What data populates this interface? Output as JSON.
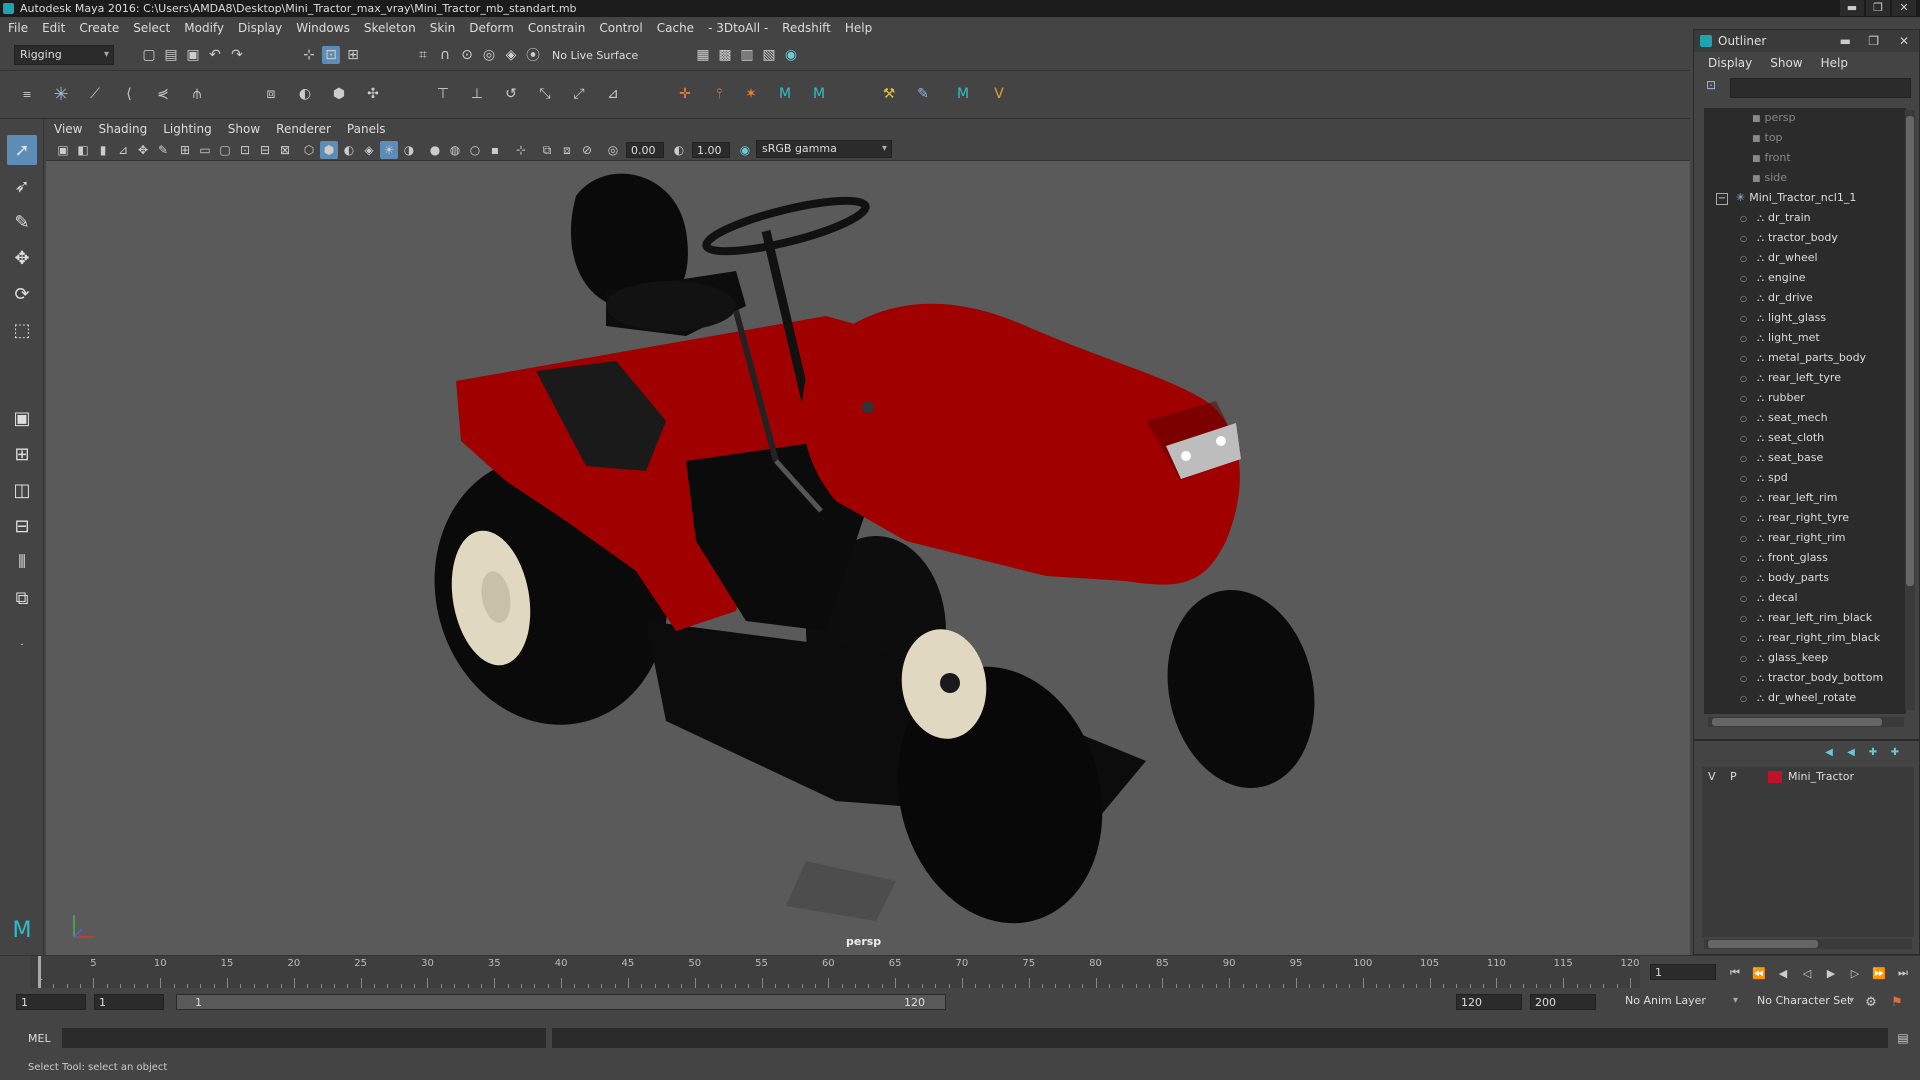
{
  "titlebar": {
    "title": "Autodesk Maya 2016: C:\\Users\\AMDA8\\Desktop\\Mini_Tractor_max_vray\\Mini_Tractor_mb_standart.mb",
    "min": "▬",
    "max": "❐",
    "close": "✕"
  },
  "menubar": {
    "items": [
      "File",
      "Edit",
      "Create",
      "Select",
      "Modify",
      "Display",
      "Windows",
      "Skeleton",
      "Skin",
      "Deform",
      "Constrain",
      "Control",
      "Cache",
      "- 3DtoAll -",
      "Redshift",
      "Help"
    ]
  },
  "shelf": {
    "mode_menu": "Rigging",
    "live_surface": "No Live Surface"
  },
  "viewport": {
    "menu": [
      "View",
      "Shading",
      "Lighting",
      "Show",
      "Renderer",
      "Panels"
    ],
    "near_value": "0.00",
    "far_value": "1.00",
    "color_space": "sRGB gamma",
    "camera_label": "persp",
    "colors": {
      "background": "#5a5a5a",
      "tractor_body": "#a00000",
      "tyre": "#0a0a0a",
      "rim": "#e0d8c0"
    }
  },
  "outliner": {
    "title": "Outliner",
    "menu": [
      "Display",
      "Show",
      "Help"
    ],
    "cameras": [
      "persp",
      "top",
      "front",
      "side"
    ],
    "group": "Mini_Tractor_ncl1_1",
    "children": [
      "dr_train",
      "tractor_body",
      "dr_wheel",
      "engine",
      "dr_drive",
      "light_glass",
      "light_met",
      "metal_parts_body",
      "rear_left_tyre",
      "rubber",
      "seat_mech",
      "seat_cloth",
      "seat_base",
      "spd",
      "rear_left_rim",
      "rear_right_tyre",
      "rear_right_rim",
      "front_glass",
      "body_parts",
      "decal",
      "rear_left_rim_black",
      "rear_right_rim_black",
      "glass_keep",
      "tractor_body_bottom",
      "dr_wheel_rotate"
    ]
  },
  "layers": {
    "v": "V",
    "p": "P",
    "layer_name": "Mini_Tractor",
    "layer_color": "#c0102a"
  },
  "timeline": {
    "labels": [
      "1",
      "5",
      "10",
      "15",
      "20",
      "25",
      "30",
      "35",
      "40",
      "45",
      "50",
      "55",
      "60",
      "65",
      "70",
      "75",
      "80",
      "85",
      "90",
      "95",
      "100",
      "105",
      "110",
      "115",
      "120"
    ],
    "current_frame": "1"
  },
  "range": {
    "start": "1",
    "start2": "1",
    "slider_start": "1",
    "slider_end": "120",
    "end": "120",
    "end2": "200",
    "anim_layer": "No Anim Layer",
    "char_set": "No Character Set"
  },
  "cmdline": {
    "label": "MEL"
  },
  "helpline": {
    "text": "Select Tool: select an object"
  }
}
